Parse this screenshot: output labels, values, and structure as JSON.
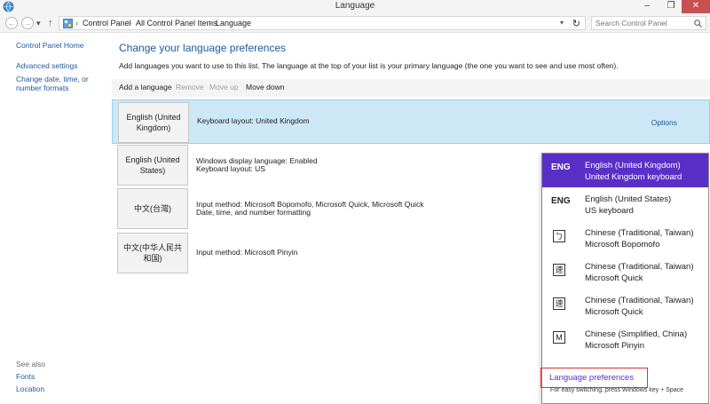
{
  "window": {
    "title": "Language"
  },
  "address": {
    "crumbs": [
      "Control Panel",
      "All Control Panel Items",
      "Language"
    ],
    "search_placeholder": "Search Control Panel"
  },
  "leftnav": {
    "links": [
      "Control Panel Home",
      "Advanced settings",
      "Change date, time, or number formats"
    ],
    "see_also_label": "See also",
    "see_also_links": [
      "Fonts",
      "Location"
    ]
  },
  "main": {
    "heading": "Change your language preferences",
    "description": "Add languages you want to use to this list. The language at the top of your list is your primary language (the one you want to see and use most often).",
    "toolbar": [
      "Add a language",
      "Remove",
      "Move up",
      "Move down"
    ],
    "options_label": "Options",
    "languages": [
      {
        "name": "English (United Kingdom)",
        "info": [
          "Keyboard layout: United Kingdom"
        ]
      },
      {
        "name": "English (United States)",
        "info": [
          "Windows display language: Enabled",
          "Keyboard layout: US"
        ]
      },
      {
        "name": "中文(台灣)",
        "info": [
          "Input method: Microsoft Bopomofo, Microsoft Quick, Microsoft Quick",
          "Date, time, and number formatting"
        ]
      },
      {
        "name": "中文(中华人民共和国)",
        "info": [
          "Input method: Microsoft Pinyin"
        ]
      }
    ]
  },
  "flyout": {
    "items": [
      {
        "code": "ENG",
        "line1": "English (United Kingdom)",
        "line2": "United Kingdom keyboard"
      },
      {
        "code": "ENG",
        "line1": "English (United States)",
        "line2": "US keyboard"
      },
      {
        "code": "ㄅ",
        "line1": "Chinese (Traditional, Taiwan)",
        "line2": "Microsoft Bopomofo"
      },
      {
        "code": "速",
        "line1": "Chinese (Traditional, Taiwan)",
        "line2": "Microsoft Quick"
      },
      {
        "code": "速",
        "line1": "Chinese (Traditional, Taiwan)",
        "line2": "Microsoft Quick"
      },
      {
        "code": "M",
        "line1": "Chinese (Simplified, China)",
        "line2": "Microsoft Pinyin"
      }
    ],
    "preferences_link": "Language preferences",
    "hint": "For easy switching, press Windows key + Space"
  },
  "colors": {
    "accent": "#5a2fc8",
    "link": "#1e5aa0",
    "selected_row": "#cce8f7",
    "highlight_box": "#e23030"
  },
  "icons": [
    "globe-icon",
    "minimize-icon",
    "restore-icon",
    "close-icon",
    "back-icon",
    "forward-icon",
    "up-arrow-icon",
    "refresh-icon",
    "search-icon"
  ]
}
